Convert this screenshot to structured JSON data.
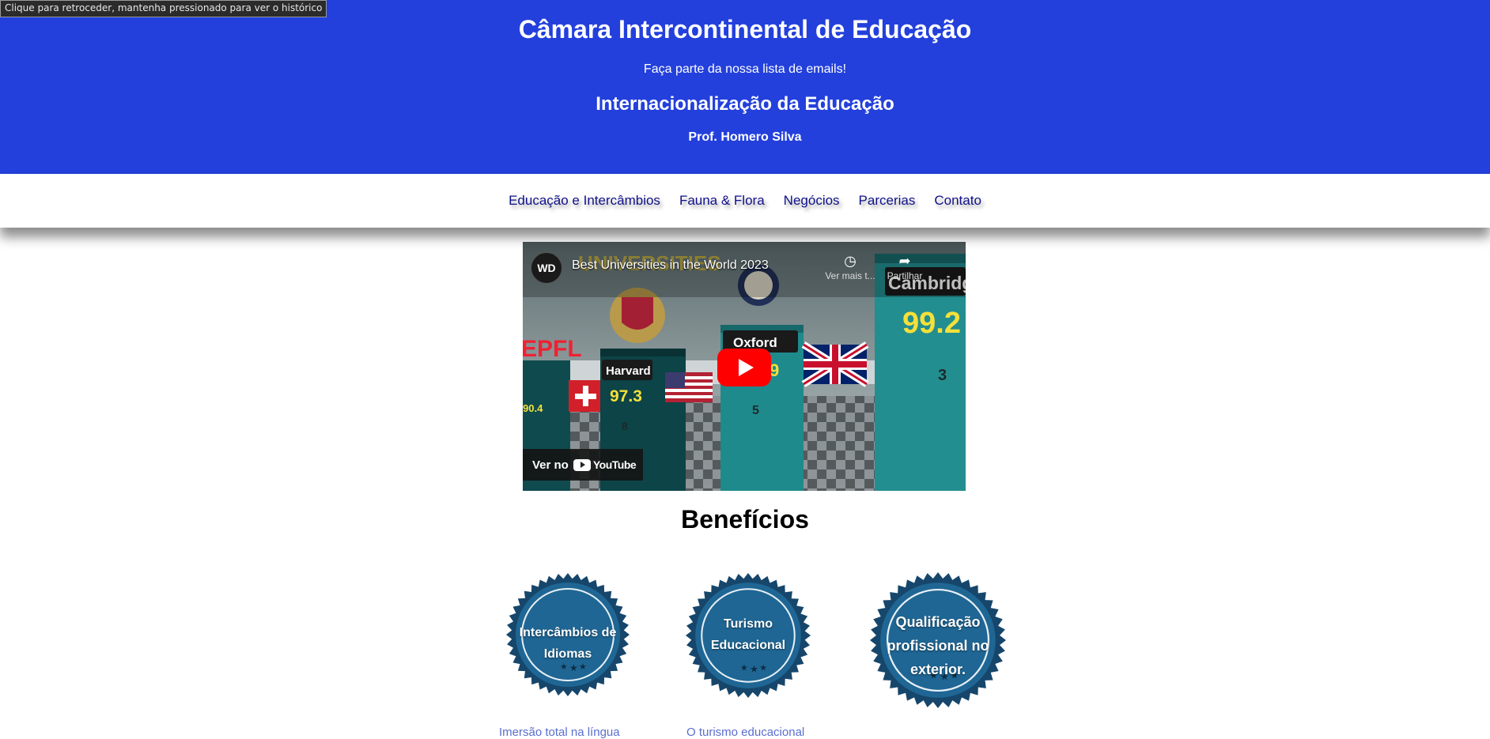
{
  "tooltip": "Clique para retroceder, mantenha pressionado para ver o histórico",
  "header": {
    "site_title": "Câmara Intercontinental de Educação",
    "email_cta": "Faça parte da nossa lista de emails!",
    "subtitle": "Internacionalização da Educação",
    "author": "Prof. Homero Silva"
  },
  "nav": [
    {
      "label": "Educação e Intercâmbios"
    },
    {
      "label": "Fauna & Flora"
    },
    {
      "label": "Negócios"
    },
    {
      "label": "Parcerias"
    },
    {
      "label": "Contato"
    }
  ],
  "video": {
    "title": "Best Universities in the World 2023",
    "channel_avatar": "WD",
    "watch_later": "Ver mais t...",
    "share": "Partilhar",
    "watch_on": "Ver no",
    "platform": "YouTube",
    "play_icon": "play-icon",
    "thumbnail": {
      "banner": "UNIVERSITIES",
      "schools": [
        {
          "name": "EPFL",
          "score": "90.4"
        },
        {
          "name": "Harvard",
          "score": "97.3",
          "rank": "8"
        },
        {
          "name": "Oxford",
          "score": "9",
          "rank": "5"
        },
        {
          "name": "Cambridge",
          "score": "99.2",
          "rank": "3"
        }
      ]
    }
  },
  "benefits": {
    "title": "Benefícios",
    "items": [
      {
        "badge_lines": [
          "Intercâmbios de",
          "Idiomas"
        ],
        "desc": "Imersão total na língua"
      },
      {
        "badge_lines": [
          "Turismo",
          "Educacional"
        ],
        "desc": "O turismo educacional"
      },
      {
        "badge_lines": [
          "Qualificação",
          "profissional no",
          "exterior."
        ],
        "desc": ""
      }
    ]
  },
  "colors": {
    "header_bg": "#2340dc",
    "nav_text": "#10108a",
    "badge_blue": "#1e5f8e",
    "play_red": "#ff0000",
    "desc_text": "#5a6ed0"
  }
}
